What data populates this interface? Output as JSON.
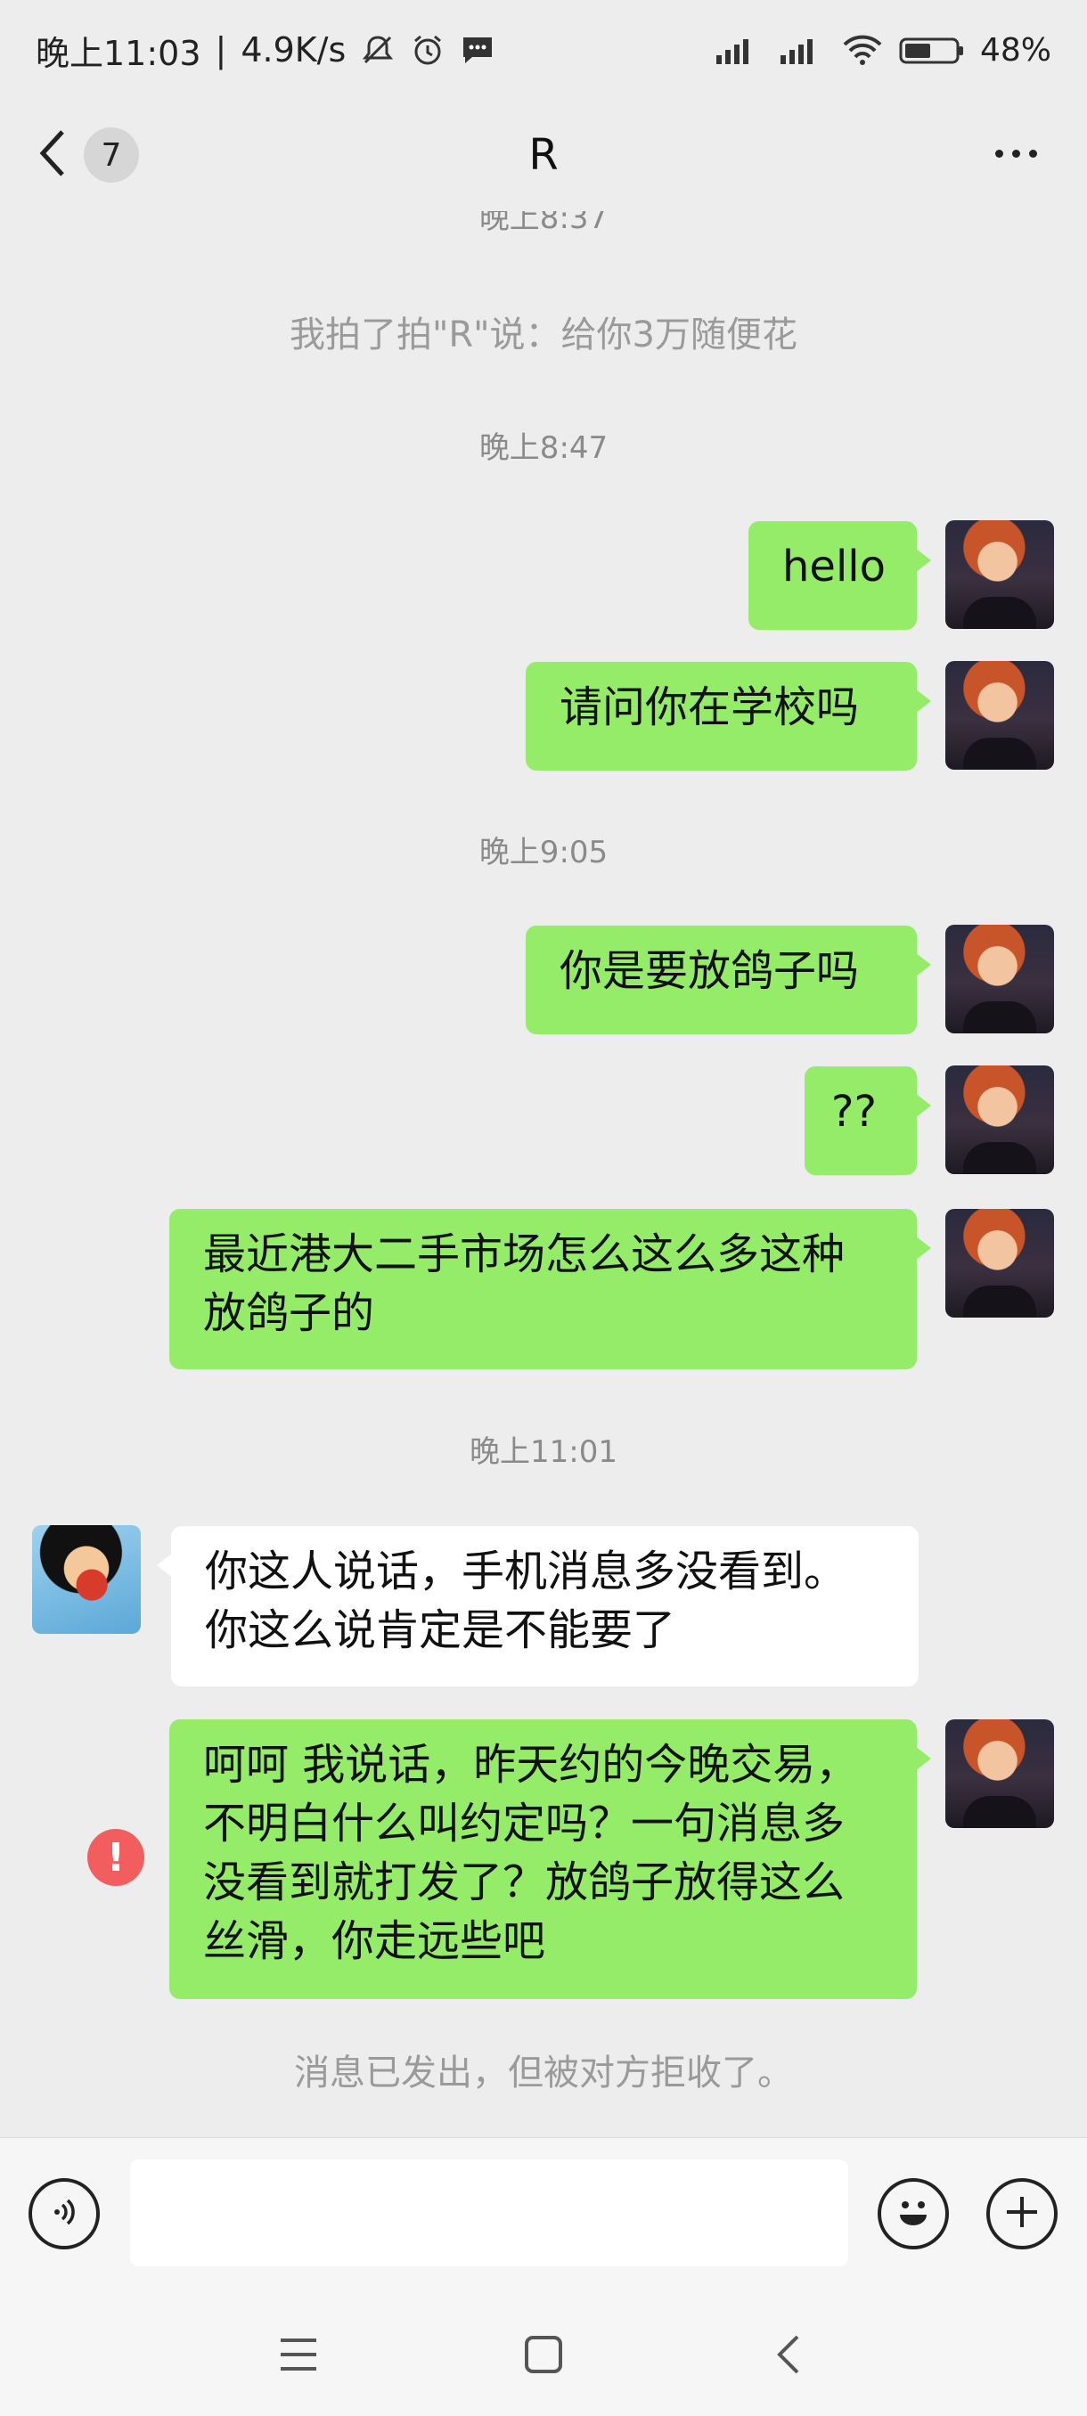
{
  "status_bar": {
    "time": "晚上11:03",
    "speed": "4.9K/s",
    "battery": "48%"
  },
  "header": {
    "back_badge": "7",
    "title": "R"
  },
  "chat": {
    "partial_time": "晚上8:37",
    "pat_notice": "我拍了拍\"R\"说：给你3万随便花",
    "time1": "晚上8:47",
    "msg1": "hello",
    "msg2": "请问你在学校吗",
    "time2": "晚上9:05",
    "msg3": "你是要放鸽子吗",
    "msg4": "??",
    "msg5": "最近港大二手市场怎么这么多这种\n放鸽子的",
    "time3": "晚上11:01",
    "msg6": "你这人说话，手机消息多没看到。\n你这么说肯定是不能要了",
    "msg7": "呵呵 我说话，昨天约的今晚交易，\n不明白什么叫约定吗？一句消息多\n没看到就打发了？放鸽子放得这么\n丝滑，你走远些吧",
    "rejected_notice": "消息已发出，但被对方拒收了。",
    "error_mark": "!"
  },
  "icons": {
    "mute": "bell-off-icon",
    "alarm": "alarm-icon",
    "message": "message-icon",
    "signal": "signal-icon",
    "wifi": "wifi-icon",
    "battery": "battery-icon",
    "voice": "voice-icon",
    "emoji": "emoji-icon",
    "add": "plus-icon"
  },
  "colors": {
    "my_bubble": "#95ec69",
    "their_bubble": "#ffffff",
    "error": "#f25e5e",
    "background": "#ededed"
  }
}
